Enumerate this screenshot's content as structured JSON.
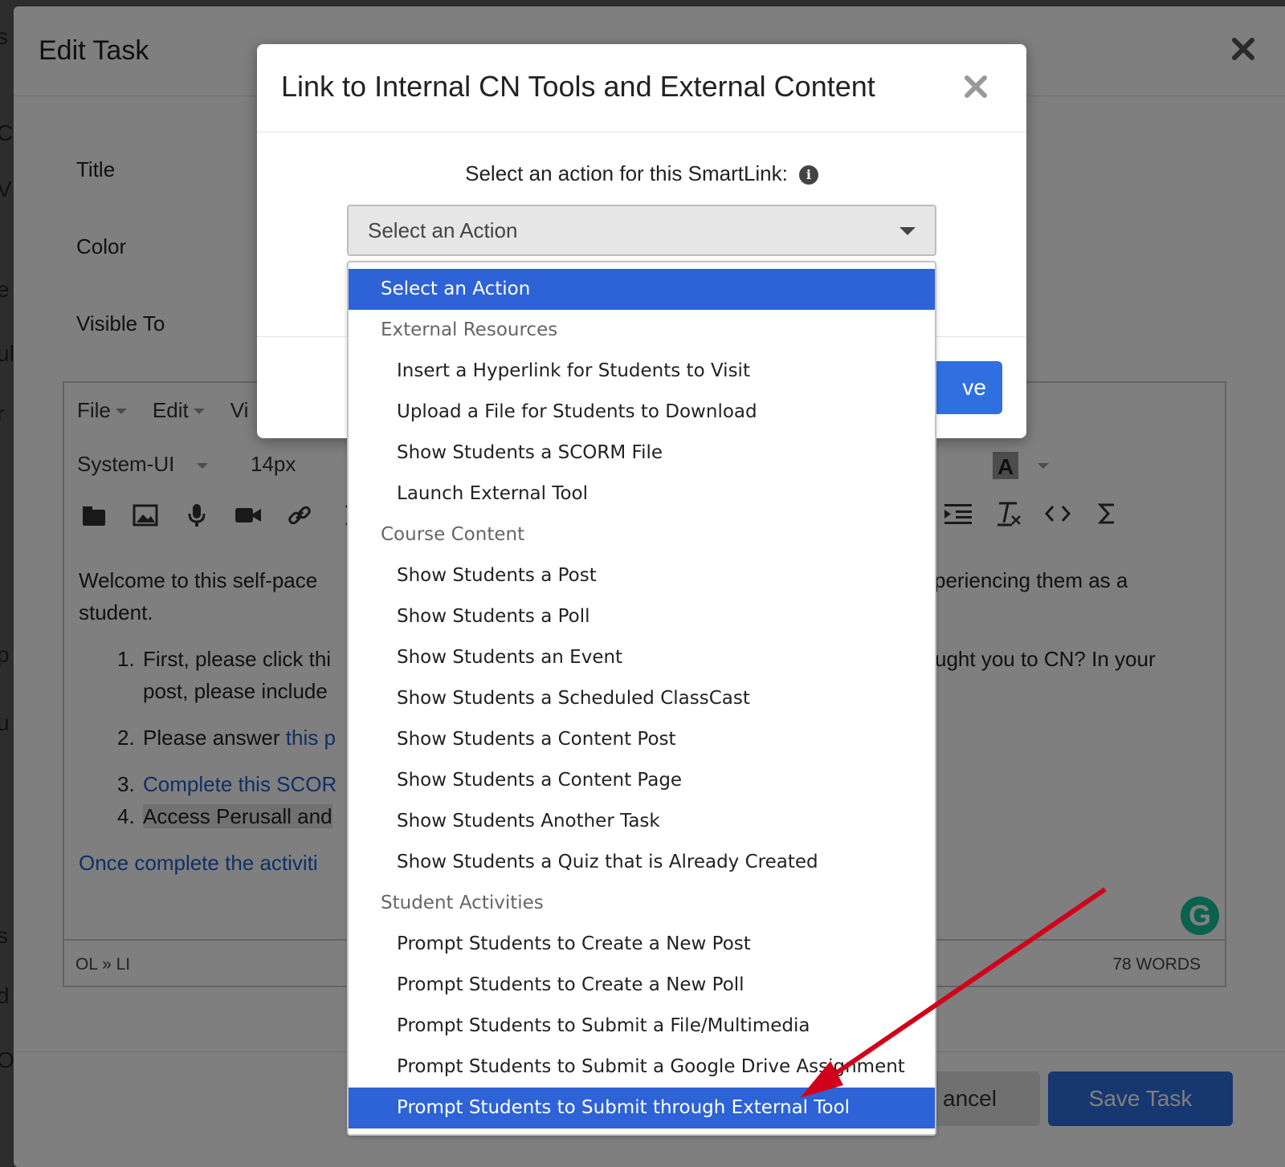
{
  "background": {
    "edge_letters": [
      "s",
      "C",
      "V",
      "e",
      "ul",
      "r",
      "p",
      "u",
      "s",
      "d",
      "O"
    ]
  },
  "edit_task": {
    "title": "Edit Task",
    "labels": {
      "title": "Title",
      "color": "Color",
      "visible_to": "Visible To"
    },
    "editor": {
      "menu": [
        "File",
        "Edit",
        "Vi"
      ],
      "font_family": "System-UI",
      "font_size": "14px",
      "content": {
        "paragraph1": "Welcome to this self-pace",
        "paragraph1_tail": "periencing them as a",
        "paragraph1_line2": "student.",
        "item1_num": "1.",
        "item1_text": "First, please click thi",
        "item1_tail": "ught you to CN? In your",
        "item1_line2": "post, please include",
        "item2_num": "2.",
        "item2_text": "Please answer ",
        "item2_link": "this p",
        "item3_num": "3.",
        "item3_link": "Complete this SCOR",
        "item4_num": "4.",
        "item4_text": "Access Perusall and",
        "closing_link": "Once complete the activiti"
      },
      "status_path": "OL » LI",
      "word_count": "78 WORDS"
    },
    "buttons": {
      "cancel": "ancel",
      "save": "Save Task"
    }
  },
  "smartlink": {
    "title": "Link to Internal CN Tools and External Content",
    "prompt": "Select an action for this SmartLink:",
    "select_value": "Select an Action",
    "save_label": "ve",
    "options": [
      {
        "label": "Select an Action",
        "kind": "top",
        "selected": true
      },
      {
        "label": "External Resources",
        "kind": "group"
      },
      {
        "label": "Insert a Hyperlink for Students to Visit",
        "kind": "child"
      },
      {
        "label": "Upload a File for Students to Download",
        "kind": "child"
      },
      {
        "label": "Show Students a SCORM File",
        "kind": "child"
      },
      {
        "label": "Launch External Tool",
        "kind": "child"
      },
      {
        "label": "Course Content",
        "kind": "group"
      },
      {
        "label": "Show Students a Post",
        "kind": "child"
      },
      {
        "label": "Show Students a Poll",
        "kind": "child"
      },
      {
        "label": "Show Students an Event",
        "kind": "child"
      },
      {
        "label": "Show Students a Scheduled ClassCast",
        "kind": "child"
      },
      {
        "label": "Show Students a Content Post",
        "kind": "child"
      },
      {
        "label": "Show Students a Content Page",
        "kind": "child"
      },
      {
        "label": "Show Students Another Task",
        "kind": "child"
      },
      {
        "label": "Show Students a Quiz that is Already Created",
        "kind": "child"
      },
      {
        "label": "Student Activities",
        "kind": "group"
      },
      {
        "label": "Prompt Students to Create a New Post",
        "kind": "child"
      },
      {
        "label": "Prompt Students to Create a New Poll",
        "kind": "child"
      },
      {
        "label": "Prompt Students to Submit a File/Multimedia",
        "kind": "child"
      },
      {
        "label": "Prompt Students to Submit a Google Drive Assignment",
        "kind": "child"
      },
      {
        "label": "Prompt Students to Submit through External Tool",
        "kind": "child",
        "selected": true
      }
    ]
  },
  "colors": {
    "accent": "#2d63d6",
    "annotation_arrow": "#d0021b"
  }
}
